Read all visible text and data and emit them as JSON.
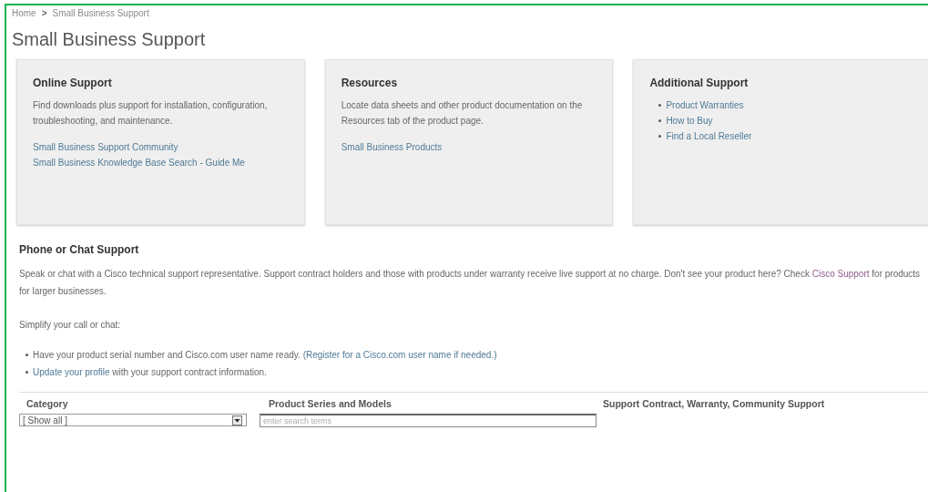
{
  "breadcrumb": {
    "items": [
      "Home",
      "Small Business Support"
    ],
    "separator": ">"
  },
  "title": "Small Business Support",
  "cards": [
    {
      "title": "Online Support",
      "text": "Find downloads plus support for installation, configuration, troubleshooting, and maintenance.",
      "kind": "plain",
      "links": [
        "Small Business Support Community",
        "Small Business Knowledge Base Search - Guide Me"
      ]
    },
    {
      "title": "Resources",
      "text": "Locate data sheets and other product documentation on the Resources tab of the product page.",
      "kind": "plain",
      "links": [
        "Small Business Products"
      ]
    },
    {
      "title": "Additional Support",
      "kind": "bullets",
      "links": [
        "Product Warranties",
        "How to Buy",
        "Find a Local Reseller"
      ]
    }
  ],
  "phone_section": {
    "heading": "Phone or Chat Support",
    "intro": [
      {
        "kind": "text",
        "text": "Speak or chat with a Cisco technical support representative. Support contract holders and those with products under warranty receive live support at no charge. Don't see your product here? Check "
      },
      {
        "kind": "link",
        "text": "Cisco Support"
      },
      {
        "kind": "text",
        "text": " for products for larger businesses."
      }
    ],
    "simplify": "Simplify your call or chat:",
    "bullets": [
      [
        {
          "kind": "text",
          "text": "Have your product serial number and Cisco.com user name ready. "
        },
        {
          "kind": "link",
          "text": "(Register for a Cisco.com user name if needed.)"
        }
      ],
      [
        {
          "kind": "link",
          "text": "Update your profile"
        },
        {
          "kind": "text",
          "text": " with your support contract information."
        }
      ]
    ]
  },
  "filters": {
    "columns": [
      "Category",
      "Product Series and Models",
      "Support Contract, Warranty, Community Support"
    ],
    "category_select": {
      "value": "[ Show all ]"
    },
    "search": {
      "placeholder": "enter search terms"
    }
  }
}
